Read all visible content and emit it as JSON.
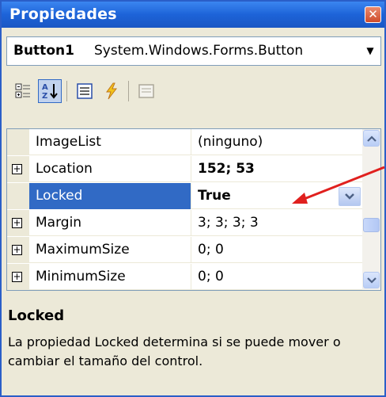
{
  "window": {
    "title": "Propiedades",
    "close_glyph": "✕"
  },
  "selector": {
    "object_name": "Button1",
    "object_type": "System.Windows.Forms.Button",
    "arrow_glyph": "▼"
  },
  "toolbar": {
    "buttons": [
      {
        "icon": "categorized-icon",
        "active": false
      },
      {
        "icon": "alphabetical-icon",
        "active": true
      },
      {
        "icon": "properties-icon",
        "active": false
      },
      {
        "icon": "events-icon",
        "active": false
      },
      {
        "icon": "property-pages-icon",
        "active": false
      }
    ]
  },
  "grid": {
    "rows": [
      {
        "name": "ImageList",
        "value": "(ninguno)",
        "expandable": false,
        "value_bold": false,
        "selected": false
      },
      {
        "name": "Location",
        "value": "152; 53",
        "expandable": true,
        "value_bold": true,
        "selected": false
      },
      {
        "name": "Locked",
        "value": "True",
        "expandable": false,
        "value_bold": true,
        "selected": true
      },
      {
        "name": "Margin",
        "value": "3; 3; 3; 3",
        "expandable": true,
        "value_bold": false,
        "selected": false
      },
      {
        "name": "MaximumSize",
        "value": "0; 0",
        "expandable": true,
        "value_bold": false,
        "selected": false
      },
      {
        "name": "MinimumSize",
        "value": "0; 0",
        "expandable": true,
        "value_bold": false,
        "selected": false
      }
    ],
    "expander_glyph": "+"
  },
  "description": {
    "title": "Locked",
    "text": "La propiedad Locked determina si se puede mover o cambiar el tamaño del control."
  },
  "colors": {
    "titlebar": "#1d63d8",
    "selection": "#316ac5",
    "panel": "#ece9d8",
    "annotation_arrow": "#e0201e"
  }
}
